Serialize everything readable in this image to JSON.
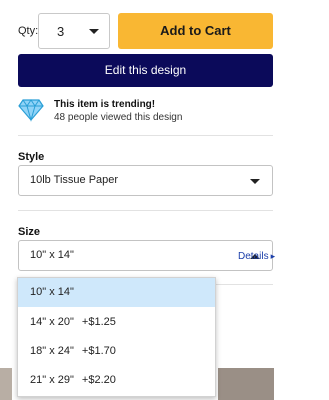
{
  "quantity": {
    "label": "Qty:",
    "value": "3"
  },
  "buttons": {
    "add_to_cart": "Add to Cart",
    "edit_design": "Edit this design"
  },
  "trending": {
    "title": "This item is trending!",
    "subtitle": "48 people viewed this design",
    "icon": "diamond-icon"
  },
  "style": {
    "label": "Style",
    "value": "10lb Tissue Paper"
  },
  "size": {
    "label": "Size",
    "value": "10\" x 14\"",
    "details_label": "Details",
    "options": [
      {
        "label": "10\" x 14\"",
        "price": ""
      },
      {
        "label": "14\" x 20\"",
        "price": "+$1.25"
      },
      {
        "label": "18\" x 24\"",
        "price": "+$1.70"
      },
      {
        "label": "21\" x 29\"",
        "price": "+$2.20"
      }
    ]
  },
  "colors": {
    "add_to_cart_bg": "#f9b733",
    "edit_design_bg": "#0b0a5a",
    "selected_option_bg": "#cfe8fb",
    "link": "#1c3faa"
  }
}
